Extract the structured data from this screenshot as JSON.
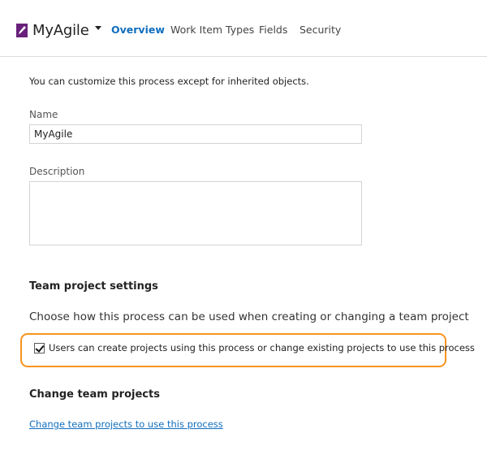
{
  "header": {
    "process_name": "MyAgile",
    "process_icon": "pencil-icon",
    "dropdown_icon": "caret-down-icon",
    "accent_color": "#106ebe",
    "process_icon_color": "#68217a",
    "tabs": [
      {
        "label": "Overview",
        "active": true
      },
      {
        "label": "Work Item Types",
        "active": false
      },
      {
        "label": "Fields",
        "active": false
      },
      {
        "label": "Security",
        "active": false
      }
    ]
  },
  "main": {
    "intro_text": "You can customize this process except for inherited objects.",
    "name_label": "Name",
    "name_value": "MyAgile",
    "description_label": "Description",
    "description_value": "",
    "team_settings_heading": "Team project settings",
    "choose_text": "Choose how this process can be used when creating or changing a team project",
    "checkbox_label": "Users can create projects using this process or change existing projects to use this process",
    "checkbox_checked": true,
    "highlight_color": "#f7941d",
    "change_projects_heading": "Change team projects",
    "change_projects_link": "Change team projects to use this process"
  }
}
